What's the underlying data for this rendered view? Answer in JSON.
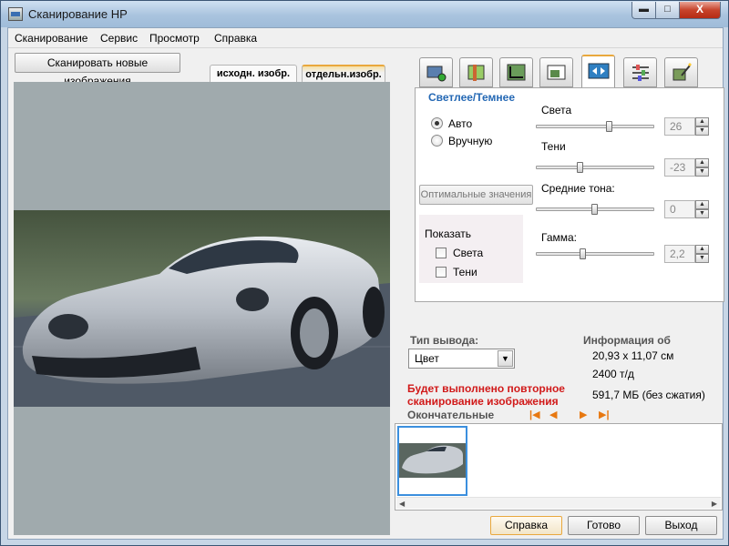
{
  "window": {
    "title": "Сканирование HP",
    "min_glyph": "▬",
    "max_glyph": "□",
    "close_glyph": "X",
    "titlebar_color": "#a9c3de"
  },
  "menu": [
    "Сканирование",
    "Сервис",
    "Просмотр",
    "Справка"
  ],
  "left": {
    "scan_new_button": "Сканировать новые изображения",
    "tabs": [
      "исходн. изобр.",
      "отдельн.изобр."
    ],
    "active_tab_index": 1,
    "preview_bg": "#a0aaad"
  },
  "tool_tabs": [
    {
      "icon": "scan-settings-icon",
      "active": false
    },
    {
      "icon": "color-adjust-icon",
      "active": false
    },
    {
      "icon": "crop-icon",
      "active": false
    },
    {
      "icon": "resize-image-icon",
      "active": false
    },
    {
      "icon": "lighten-darken-icon",
      "active": true
    },
    {
      "icon": "sliders-icon",
      "active": false
    },
    {
      "icon": "magic-wand-icon",
      "active": false
    }
  ],
  "panel": {
    "title": "Светлее/Темнее",
    "mode": {
      "auto_label": "Авто",
      "manual_label": "Вручную",
      "selected": "auto"
    },
    "optimal_button": "Оптимальные значения",
    "show": {
      "label": "Показать",
      "highlights_label": "Света",
      "shadows_label": "Тени",
      "highlights_checked": false,
      "shadows_checked": false
    },
    "sliders": {
      "highlights": {
        "label": "Света",
        "value": "26",
        "position": 0.62
      },
      "shadows": {
        "label": "Тени",
        "value": "-23",
        "position": 0.38
      },
      "midtones": {
        "label": "Средние тона:",
        "value": "0",
        "position": 0.5
      },
      "gamma": {
        "label": "Гамма:",
        "value": "2,2",
        "position": 0.4
      }
    }
  },
  "output": {
    "type_label": "Тип вывода:",
    "type_value": "Цвет",
    "info_label": "Информация об",
    "size": "20,93 x 11,07 см",
    "resolution": "2400 т/д",
    "file_size": "591,7 МБ (без сжатия)",
    "warning": "Будет выполнено повторное сканирование изображения",
    "final_label": "Окончательные",
    "nav": {
      "first": "|◀",
      "prev": "◀",
      "next": "▶",
      "last": "▶|"
    }
  },
  "thumbs": {
    "scroll_left": "◀",
    "scroll_right": "▶"
  },
  "buttons": {
    "help": "Справка",
    "done": "Готово",
    "exit": "Выход"
  },
  "colors": {
    "accent_blue": "#2468b4",
    "warning_red": "#d11a1a",
    "tab_highlight": "#e9a83d",
    "car_silver": "#c7ccd2"
  }
}
